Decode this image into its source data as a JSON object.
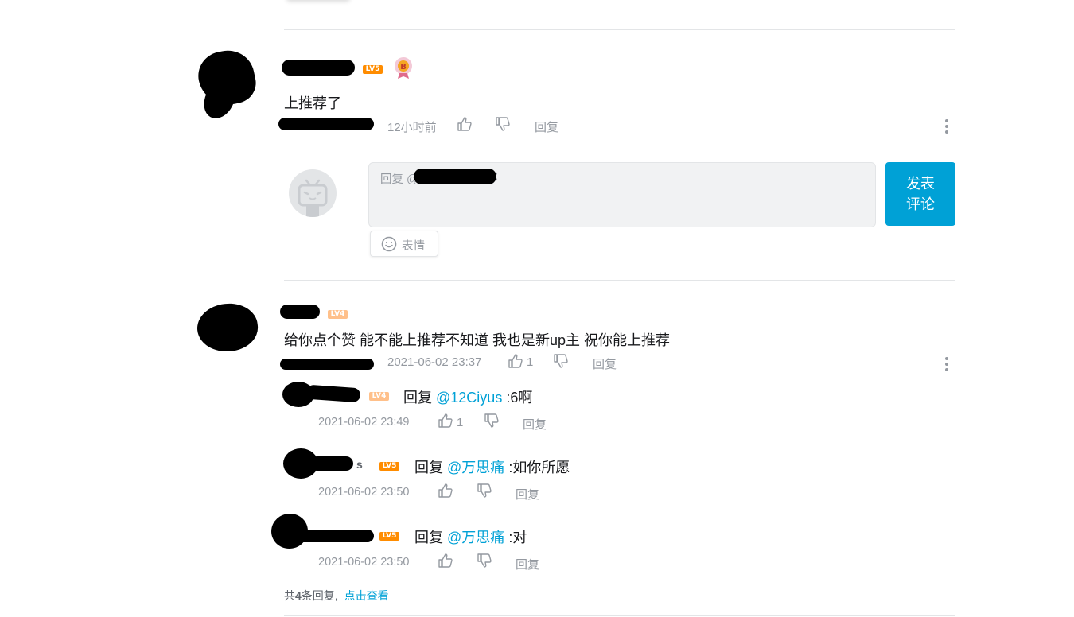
{
  "comments": [
    {
      "level": "LV5",
      "text": "上推荐了",
      "time": "12小时前",
      "likes": "",
      "reply_label": "回复",
      "has_badge": true
    },
    {
      "level": "LV4",
      "text": "给你点个赞 能不能上推荐不知道 我也是新up主 祝你能上推荐",
      "time": "2021-06-02 23:37",
      "likes": "1",
      "reply_label": "回复",
      "replies": [
        {
          "level": "LV4",
          "prefix": "回复",
          "mention": "@12Ciyus",
          "text": ":6啊",
          "time": "2021-06-02 23:49",
          "likes": "1",
          "reply_label": "回复"
        },
        {
          "level": "LV5",
          "name_tail": "s",
          "prefix": "回复",
          "mention": "@万思痛",
          "text": ":如你所愿",
          "time": "2021-06-02 23:50",
          "likes": "",
          "reply_label": "回复"
        },
        {
          "level": "LV5",
          "prefix": "回复",
          "mention": "@万思痛",
          "text": ":对",
          "time": "2021-06-02 23:50",
          "likes": "",
          "reply_label": "回复"
        }
      ],
      "summary_prefix": "共",
      "summary_count": "4",
      "summary_suffix": "条回复,",
      "summary_link": "点击查看"
    }
  ],
  "reply_box": {
    "placeholder_prefix": "回复 @",
    "placeholder_suffix": ":",
    "emoji_label": "表情",
    "submit_line1": "发表",
    "submit_line2": "评论"
  },
  "colors": {
    "accent": "#00a1d6",
    "level5": "#ff8c00",
    "level4": "#ffc08a",
    "meta": "#9499a0"
  },
  "icons": [
    "thumbs-up-icon",
    "thumbs-down-icon",
    "more-vertical-icon",
    "smile-icon",
    "tv-avatar-icon"
  ]
}
